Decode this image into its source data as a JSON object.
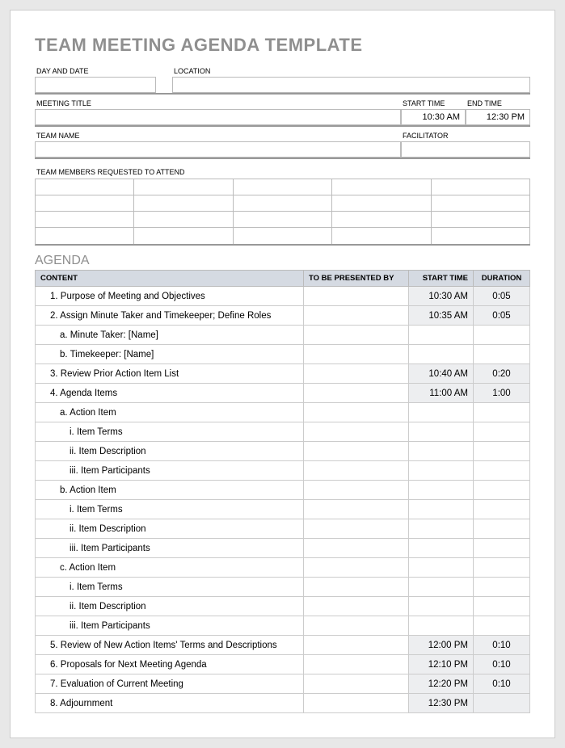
{
  "title": "TEAM MEETING AGENDA TEMPLATE",
  "labels": {
    "day_date": "DAY AND DATE",
    "location": "LOCATION",
    "meeting_title": "MEETING TITLE",
    "start_time": "START TIME",
    "end_time": "END TIME",
    "team_name": "TEAM NAME",
    "facilitator": "FACILITATOR",
    "members": "TEAM MEMBERS REQUESTED TO ATTEND"
  },
  "meeting": {
    "day_date": "",
    "location": "",
    "meeting_title": "",
    "start_time": "10:30 AM",
    "end_time": "12:30 PM",
    "team_name": "",
    "facilitator": ""
  },
  "agenda_heading": "AGENDA",
  "agenda_headers": {
    "content": "CONTENT",
    "presented": "TO BE PRESENTED BY",
    "start": "START TIME",
    "duration": "DURATION"
  },
  "agenda_rows": [
    {
      "content": "1. Purpose of Meeting and Objectives",
      "indent": 1,
      "presented": "",
      "start": "10:30 AM",
      "duration": "0:05",
      "shade": true
    },
    {
      "content": "2. Assign Minute Taker and Timekeeper; Define Roles",
      "indent": 1,
      "presented": "",
      "start": "10:35 AM",
      "duration": "0:05",
      "shade": true
    },
    {
      "content": "a. Minute Taker: [Name]",
      "indent": 2,
      "presented": "",
      "start": "",
      "duration": "",
      "shade": false
    },
    {
      "content": "b. Timekeeper: [Name]",
      "indent": 2,
      "presented": "",
      "start": "",
      "duration": "",
      "shade": false
    },
    {
      "content": "3. Review Prior Action Item List",
      "indent": 1,
      "presented": "",
      "start": "10:40 AM",
      "duration": "0:20",
      "shade": true
    },
    {
      "content": "4. Agenda Items",
      "indent": 1,
      "presented": "",
      "start": "11:00 AM",
      "duration": "1:00",
      "shade": true
    },
    {
      "content": "a. Action Item",
      "indent": 2,
      "presented": "",
      "start": "",
      "duration": "",
      "shade": false
    },
    {
      "content": "i. Item Terms",
      "indent": 3,
      "presented": "",
      "start": "",
      "duration": "",
      "shade": false
    },
    {
      "content": "ii. Item Description",
      "indent": 3,
      "presented": "",
      "start": "",
      "duration": "",
      "shade": false
    },
    {
      "content": "iii. Item Participants",
      "indent": 3,
      "presented": "",
      "start": "",
      "duration": "",
      "shade": false
    },
    {
      "content": "b. Action Item",
      "indent": 2,
      "presented": "",
      "start": "",
      "duration": "",
      "shade": false
    },
    {
      "content": "i. Item Terms",
      "indent": 3,
      "presented": "",
      "start": "",
      "duration": "",
      "shade": false
    },
    {
      "content": "ii. Item Description",
      "indent": 3,
      "presented": "",
      "start": "",
      "duration": "",
      "shade": false
    },
    {
      "content": "iii. Item Participants",
      "indent": 3,
      "presented": "",
      "start": "",
      "duration": "",
      "shade": false
    },
    {
      "content": "c. Action Item",
      "indent": 2,
      "presented": "",
      "start": "",
      "duration": "",
      "shade": false
    },
    {
      "content": "i. Item Terms",
      "indent": 3,
      "presented": "",
      "start": "",
      "duration": "",
      "shade": false
    },
    {
      "content": "ii. Item Description",
      "indent": 3,
      "presented": "",
      "start": "",
      "duration": "",
      "shade": false
    },
    {
      "content": "iii. Item Participants",
      "indent": 3,
      "presented": "",
      "start": "",
      "duration": "",
      "shade": false
    },
    {
      "content": "5. Review of New Action Items' Terms and Descriptions",
      "indent": 1,
      "presented": "",
      "start": "12:00 PM",
      "duration": "0:10",
      "shade": true
    },
    {
      "content": "6. Proposals for Next Meeting Agenda",
      "indent": 1,
      "presented": "",
      "start": "12:10 PM",
      "duration": "0:10",
      "shade": true
    },
    {
      "content": "7. Evaluation of Current Meeting",
      "indent": 1,
      "presented": "",
      "start": "12:20 PM",
      "duration": "0:10",
      "shade": true
    },
    {
      "content": "8. Adjournment",
      "indent": 1,
      "presented": "",
      "start": "12:30 PM",
      "duration": "",
      "shade": true
    }
  ]
}
